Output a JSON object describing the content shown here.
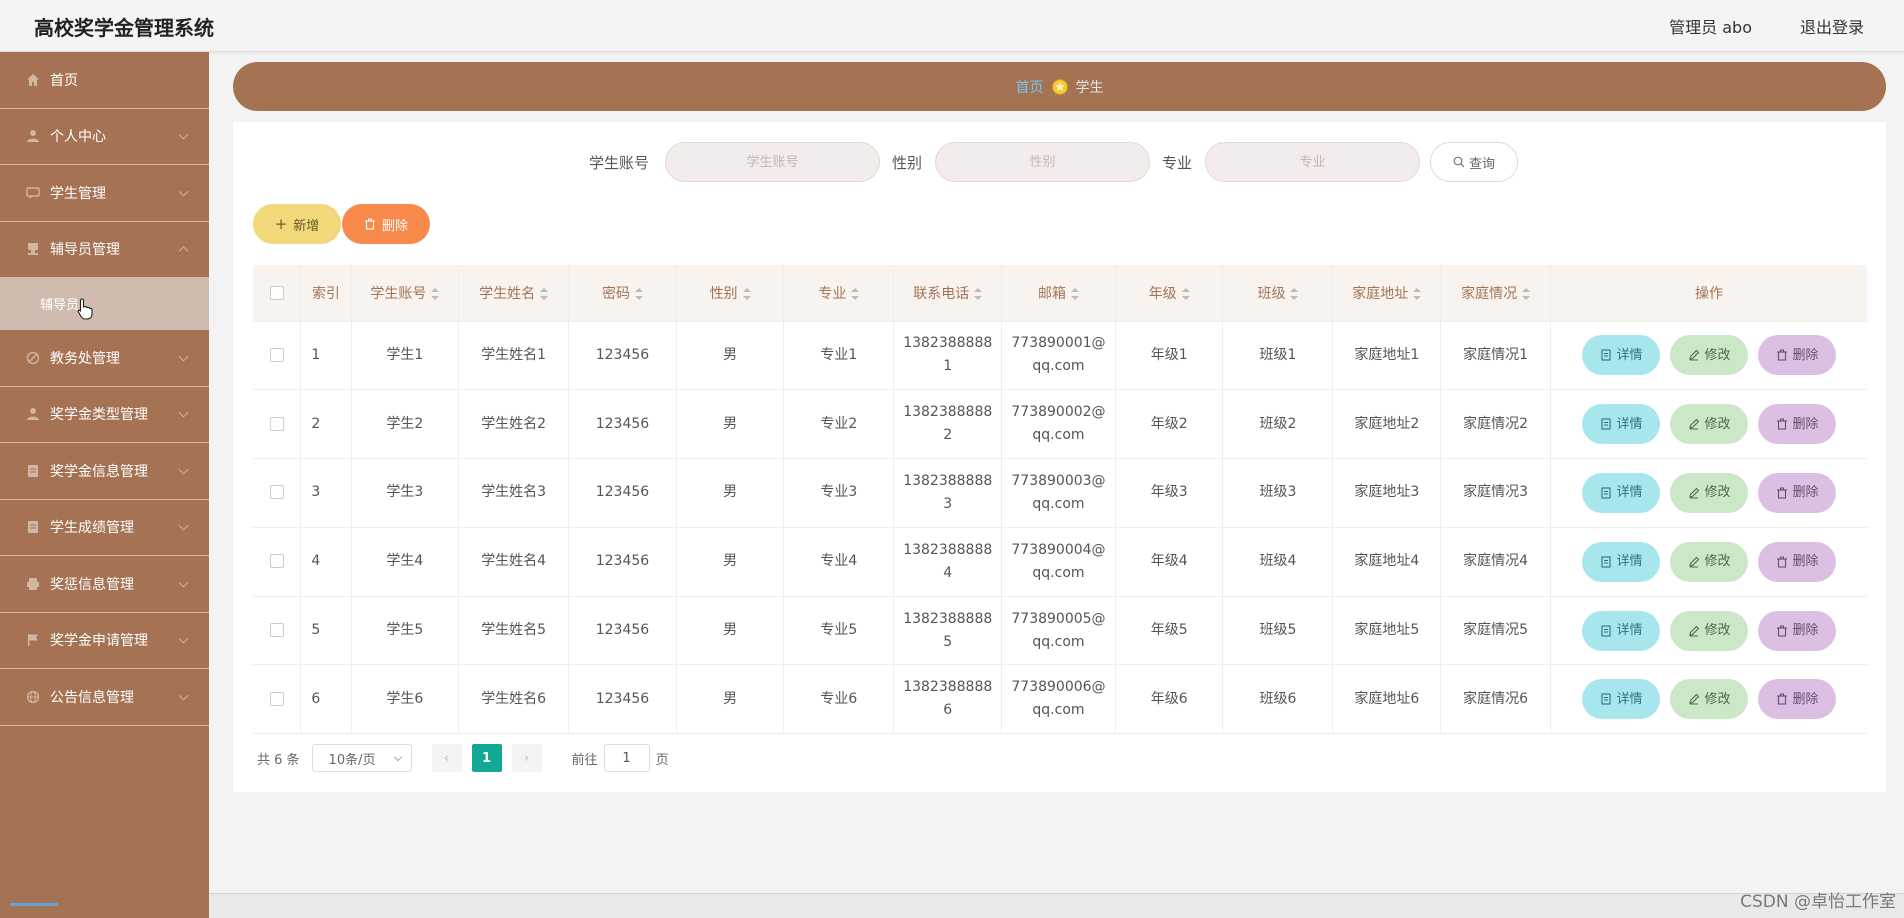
{
  "header": {
    "app_title": "高校奖学金管理系统",
    "admin_label": "管理员 abo",
    "logout_label": "退出登录"
  },
  "sidebar": {
    "items": [
      {
        "label": "首页",
        "icon": "home-icon"
      },
      {
        "label": "个人中心",
        "icon": "user-icon"
      },
      {
        "label": "学生管理",
        "icon": "chat-icon"
      },
      {
        "label": "辅导员管理",
        "icon": "stamp-icon",
        "expanded": true
      },
      {
        "label": "教务处管理",
        "icon": "forbid-icon"
      },
      {
        "label": "奖学金类型管理",
        "icon": "user-icon"
      },
      {
        "label": "奖学金信息管理",
        "icon": "doc-icon"
      },
      {
        "label": "学生成绩管理",
        "icon": "doc-icon"
      },
      {
        "label": "奖惩信息管理",
        "icon": "printer-icon"
      },
      {
        "label": "奖学金申请管理",
        "icon": "flag-icon"
      },
      {
        "label": "公告信息管理",
        "icon": "globe-icon"
      }
    ],
    "subitem": "辅导员"
  },
  "breadcrumb": {
    "home": "首页",
    "current": "学生"
  },
  "search": {
    "account_label": "学生账号",
    "account_placeholder": "学生账号",
    "gender_label": "性别",
    "gender_placeholder": "性别",
    "major_label": "专业",
    "major_placeholder": "专业",
    "query_label": "查询"
  },
  "actions": {
    "add_label": "新增",
    "delete_label": "删除"
  },
  "table": {
    "headers": [
      "索引",
      "学生账号",
      "学生姓名",
      "密码",
      "性别",
      "专业",
      "联系电话",
      "邮箱",
      "年级",
      "班级",
      "家庭地址",
      "家庭情况",
      "操作"
    ],
    "rows": [
      {
        "index": "1",
        "account": "学生1",
        "name": "学生姓名1",
        "password": "123456",
        "gender": "男",
        "major": "专业1",
        "phone1": "1382388888",
        "phone2": "1",
        "email1": "773890001@",
        "email2": "qq.com",
        "grade": "年级1",
        "class": "班级1",
        "address": "家庭地址1",
        "family": "家庭情况1"
      },
      {
        "index": "2",
        "account": "学生2",
        "name": "学生姓名2",
        "password": "123456",
        "gender": "男",
        "major": "专业2",
        "phone1": "1382388888",
        "phone2": "2",
        "email1": "773890002@",
        "email2": "qq.com",
        "grade": "年级2",
        "class": "班级2",
        "address": "家庭地址2",
        "family": "家庭情况2"
      },
      {
        "index": "3",
        "account": "学生3",
        "name": "学生姓名3",
        "password": "123456",
        "gender": "男",
        "major": "专业3",
        "phone1": "1382388888",
        "phone2": "3",
        "email1": "773890003@",
        "email2": "qq.com",
        "grade": "年级3",
        "class": "班级3",
        "address": "家庭地址3",
        "family": "家庭情况3"
      },
      {
        "index": "4",
        "account": "学生4",
        "name": "学生姓名4",
        "password": "123456",
        "gender": "男",
        "major": "专业4",
        "phone1": "1382388888",
        "phone2": "4",
        "email1": "773890004@",
        "email2": "qq.com",
        "grade": "年级4",
        "class": "班级4",
        "address": "家庭地址4",
        "family": "家庭情况4"
      },
      {
        "index": "5",
        "account": "学生5",
        "name": "学生姓名5",
        "password": "123456",
        "gender": "男",
        "major": "专业5",
        "phone1": "1382388888",
        "phone2": "5",
        "email1": "773890005@",
        "email2": "qq.com",
        "grade": "年级5",
        "class": "班级5",
        "address": "家庭地址5",
        "family": "家庭情况5"
      },
      {
        "index": "6",
        "account": "学生6",
        "name": "学生姓名6",
        "password": "123456",
        "gender": "男",
        "major": "专业6",
        "phone1": "1382388888",
        "phone2": "6",
        "email1": "773890006@",
        "email2": "qq.com",
        "grade": "年级6",
        "class": "班级6",
        "address": "家庭地址6",
        "family": "家庭情况6"
      }
    ],
    "op_detail": "详情",
    "op_edit": "修改",
    "op_delete": "删除"
  },
  "pagination": {
    "total": "共 6 条",
    "page_size": "10条/页",
    "current_page": "1",
    "goto_label": "前往",
    "goto_value": "1",
    "page_unit": "页"
  },
  "watermark": "CSDN @卓怡工作室",
  "colors": {
    "sidebar": "#a57353",
    "accent_teal": "#13a894",
    "add_btn": "#f2d879",
    "delete_btn": "#f7894a"
  }
}
